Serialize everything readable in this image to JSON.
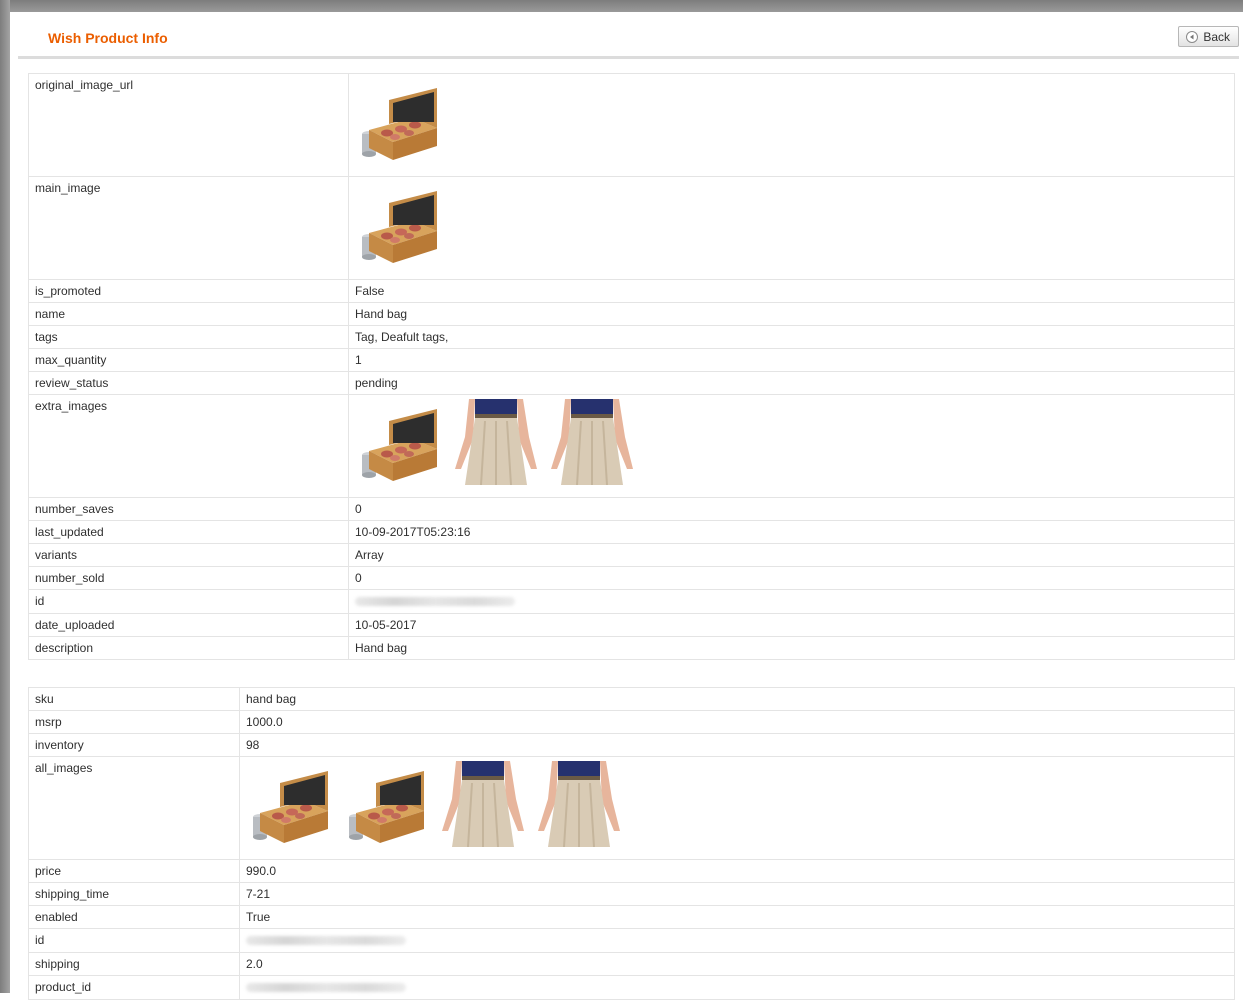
{
  "header": {
    "title": "Wish Product Info",
    "back_label": "Back"
  },
  "product": [
    {
      "key": "original_image_url",
      "images": [
        "box-icon"
      ]
    },
    {
      "key": "main_image",
      "images": [
        "box-icon"
      ]
    },
    {
      "key": "is_promoted",
      "value": "False"
    },
    {
      "key": "name",
      "value": "Hand bag"
    },
    {
      "key": "tags",
      "value": "Tag, Deafult tags,"
    },
    {
      "key": "max_quantity",
      "value": "1"
    },
    {
      "key": "review_status",
      "value": "pending"
    },
    {
      "key": "extra_images",
      "images": [
        "box-icon",
        "skirt-icon",
        "skirt-icon"
      ]
    },
    {
      "key": "number_saves",
      "value": "0"
    },
    {
      "key": "last_updated",
      "value": "10-09-2017T05:23:16"
    },
    {
      "key": "variants",
      "value": "Array"
    },
    {
      "key": "number_sold",
      "value": "0"
    },
    {
      "key": "id",
      "redacted": true
    },
    {
      "key": "date_uploaded",
      "value": "10-05-2017"
    },
    {
      "key": "description",
      "value": "Hand bag"
    }
  ],
  "variant": [
    {
      "key": "sku",
      "value": "hand bag"
    },
    {
      "key": "msrp",
      "value": "1000.0"
    },
    {
      "key": "inventory",
      "value": "98"
    },
    {
      "key": "all_images",
      "images": [
        "box-icon",
        "box-icon",
        "skirt-icon",
        "skirt-icon"
      ]
    },
    {
      "key": "price",
      "value": "990.0"
    },
    {
      "key": "shipping_time",
      "value": "7-21"
    },
    {
      "key": "enabled",
      "value": "True"
    },
    {
      "key": "id",
      "redacted": true
    },
    {
      "key": "shipping",
      "value": "2.0"
    },
    {
      "key": "product_id",
      "redacted": true
    }
  ]
}
